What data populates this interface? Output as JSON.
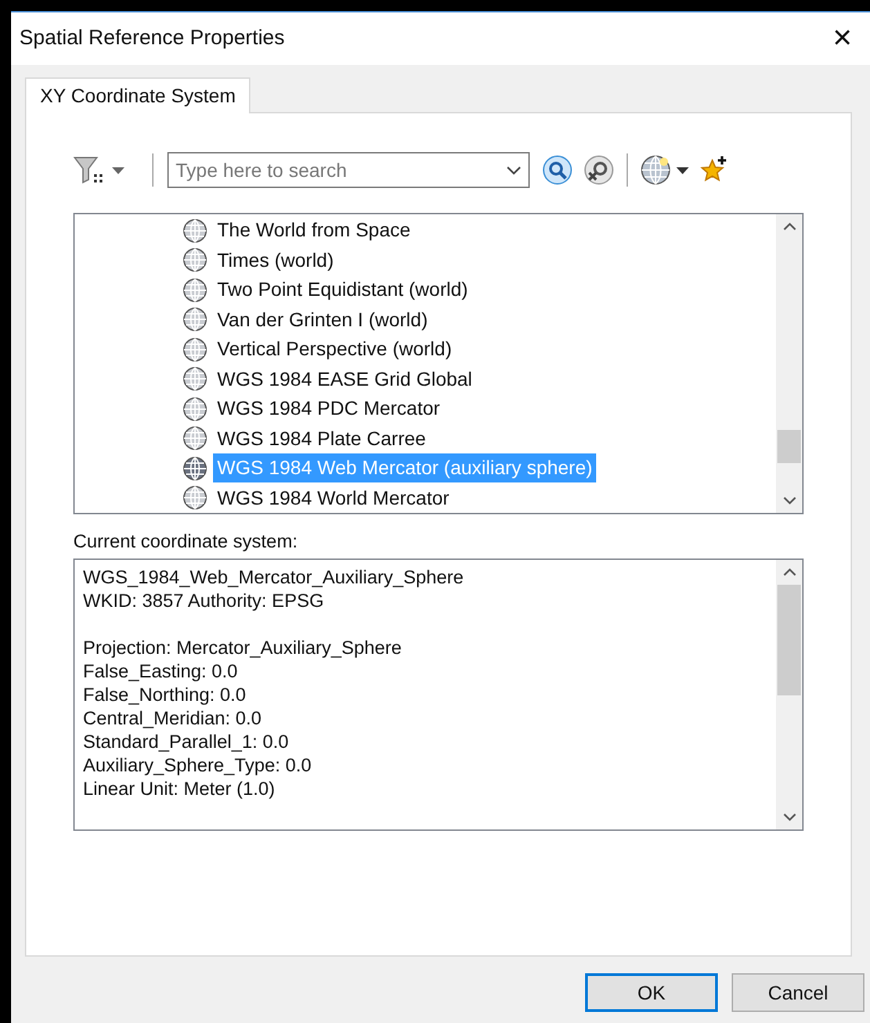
{
  "window": {
    "title": "Spatial Reference Properties",
    "close": "×"
  },
  "tabs": [
    {
      "label": "XY Coordinate System",
      "selected": true
    }
  ],
  "toolbar": {
    "search": {
      "placeholder": "Type here to search"
    }
  },
  "list": {
    "items": [
      {
        "label": "The World from Space",
        "selected": false
      },
      {
        "label": "Times (world)",
        "selected": false
      },
      {
        "label": "Two Point Equidistant (world)",
        "selected": false
      },
      {
        "label": "Van der Grinten I (world)",
        "selected": false
      },
      {
        "label": "Vertical Perspective (world)",
        "selected": false
      },
      {
        "label": "WGS 1984 EASE Grid Global",
        "selected": false
      },
      {
        "label": "WGS 1984 PDC Mercator",
        "selected": false
      },
      {
        "label": "WGS 1984 Plate Carree",
        "selected": false
      },
      {
        "label": "WGS 1984 Web Mercator (auxiliary sphere)",
        "selected": true
      },
      {
        "label": "WGS 1984 World Mercator",
        "selected": false
      }
    ]
  },
  "current": {
    "label": "Current coordinate system:",
    "lines": [
      "WGS_1984_Web_Mercator_Auxiliary_Sphere",
      "WKID: 3857 Authority: EPSG",
      {
        "kind": "gap",
        "text": "Projection: Mercator_Auxiliary_Sphere"
      },
      "False_Easting: 0.0",
      "False_Northing: 0.0",
      "Central_Meridian: 0.0",
      "Standard_Parallel_1: 0.0",
      "Auxiliary_Sphere_Type: 0.0",
      "Linear Unit: Meter (1.0)"
    ]
  },
  "buttons": [
    {
      "label": "OK",
      "default": true
    },
    {
      "label": "Cancel",
      "default": false
    }
  ]
}
